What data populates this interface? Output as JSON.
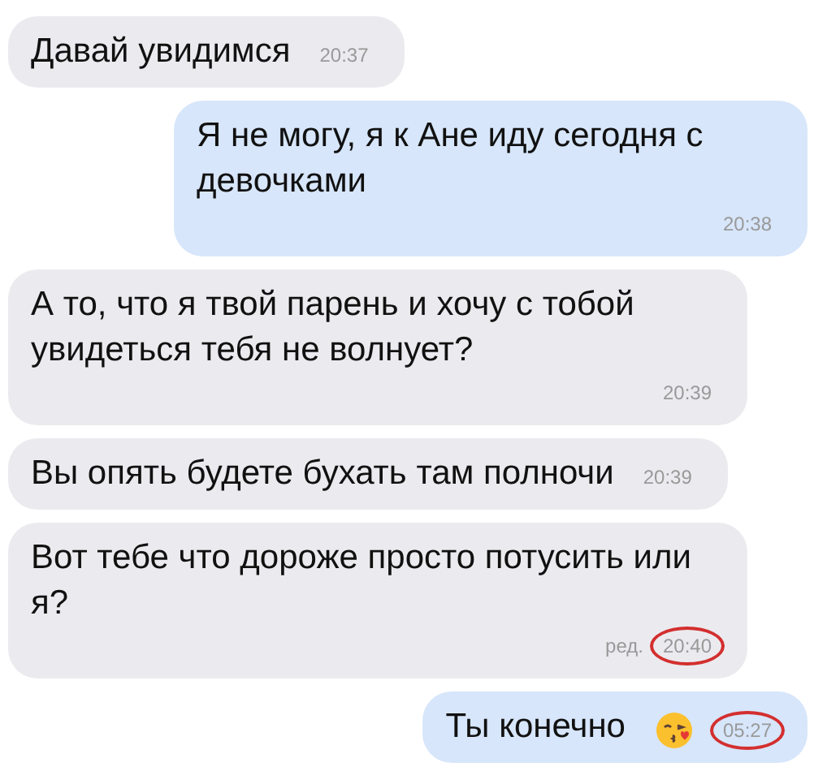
{
  "messages": [
    {
      "kind": "incoming",
      "text": "Давай увидимся",
      "time": "20:37",
      "highlighted": false
    },
    {
      "kind": "outgoing",
      "text": "Я не могу, я к Ане иду сегодня с девочками",
      "time": "20:38",
      "highlighted": false
    },
    {
      "kind": "incoming",
      "text": "А то, что я твой парень и хочу с тобой увидеться тебя не волнует?",
      "time": "20:39",
      "highlighted": false
    },
    {
      "kind": "incoming",
      "text": "Вы опять будете бухать там полночи",
      "time": "20:39",
      "highlighted": false
    },
    {
      "kind": "incoming",
      "text": "Вот тебе что дороже просто потусить или я?",
      "edited": "ред.",
      "time": "20:40",
      "highlighted": true
    },
    {
      "kind": "outgoing",
      "text": "Ты конечно",
      "has_emoji": true,
      "time": "05:27",
      "highlighted": true
    }
  ]
}
